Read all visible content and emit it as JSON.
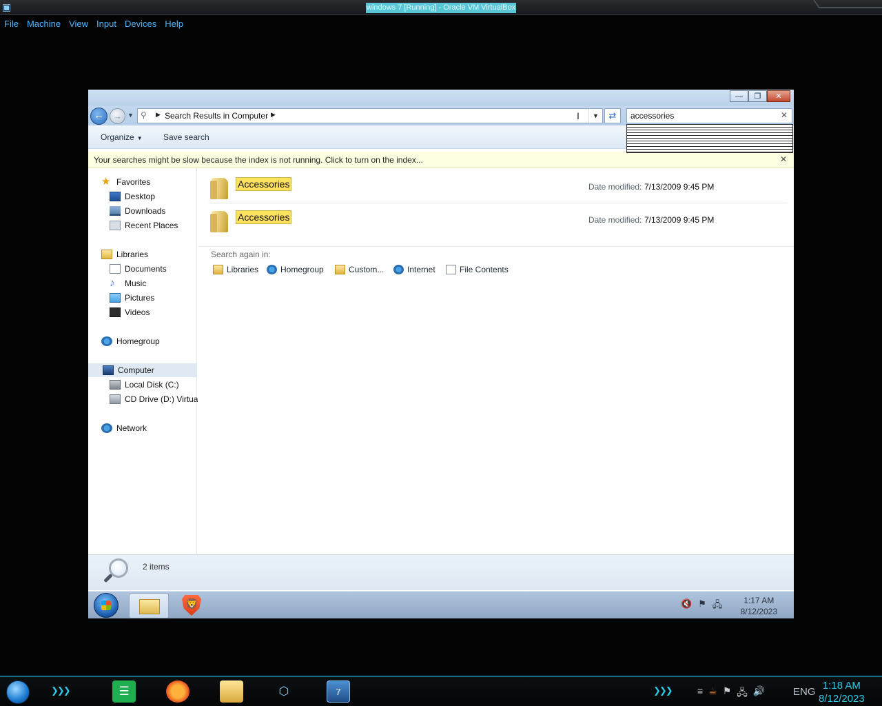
{
  "host": {
    "title": "windows 7 [Running] - Oracle VM VirtualBox",
    "menu": [
      "File",
      "Machine",
      "View",
      "Input",
      "Devices",
      "Help"
    ],
    "taskbar_time": "1:18 AM",
    "taskbar_date": "8/12/2023",
    "taskbar_lang": "ENG"
  },
  "explorer": {
    "address": "Search Results in Computer",
    "search_query": "accessories",
    "commands": {
      "organize": "Organize",
      "save_search": "Save search"
    },
    "info_bar": "Your searches might be slow because the index is not running.  Click to turn on the index...",
    "nav": {
      "favorites": "Favorites",
      "desktop": "Desktop",
      "downloads": "Downloads",
      "recent_places": "Recent Places",
      "libraries": "Libraries",
      "documents": "Documents",
      "music": "Music",
      "pictures": "Pictures",
      "videos": "Videos",
      "homegroup": "Homegroup",
      "computer": "Computer",
      "local_disk": "Local Disk (C:)",
      "cd_drive": "CD Drive (D:) Virtual",
      "network": "Network"
    },
    "results": [
      {
        "name": "Accessories",
        "date_label": "Date modified:",
        "date": "7/13/2009 9:45 PM"
      },
      {
        "name": "Accessories",
        "date_label": "Date modified:",
        "date": "7/13/2009 9:45 PM"
      }
    ],
    "search_again": {
      "label": "Search again in:",
      "options": [
        "Libraries",
        "Homegroup",
        "Custom...",
        "Internet",
        "File Contents"
      ]
    },
    "status": "2 items"
  },
  "vm_taskbar": {
    "time": "1:17 AM",
    "date": "8/12/2023"
  }
}
